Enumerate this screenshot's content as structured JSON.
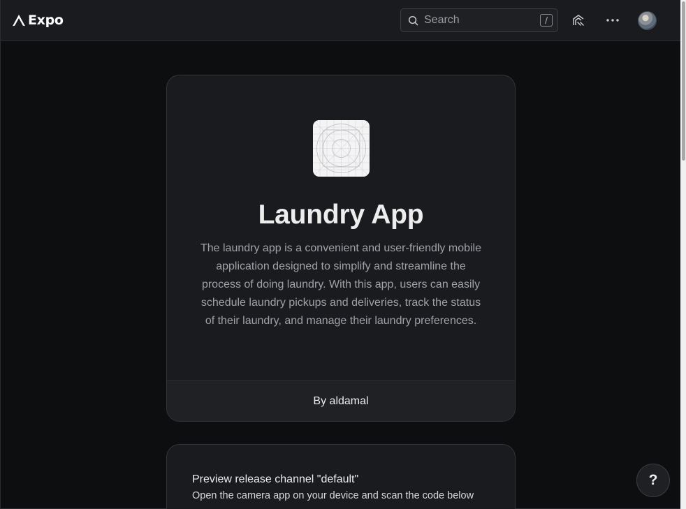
{
  "header": {
    "logo_text": "Expo",
    "search": {
      "placeholder": "Search",
      "shortcut": "/"
    },
    "more_label": "···"
  },
  "project": {
    "title": "Laundry App",
    "description": "The laundry app is a convenient and user-friendly mobile application designed to simplify and streamline the process of doing laundry. With this app, users can easily schedule laundry pickups and deliveries, track the status of their laundry, and manage their laundry preferences.",
    "author": "By aldamal"
  },
  "preview": {
    "title": "Preview release channel \"default\"",
    "instructions": "Open the camera app on your device and scan the code below"
  },
  "help": {
    "label": "?"
  },
  "colors": {
    "background": "#0d0e10",
    "surface": "#1a1b1e",
    "border": "#33353a",
    "text": "#ededed",
    "muted_text": "#a0a2a8"
  }
}
